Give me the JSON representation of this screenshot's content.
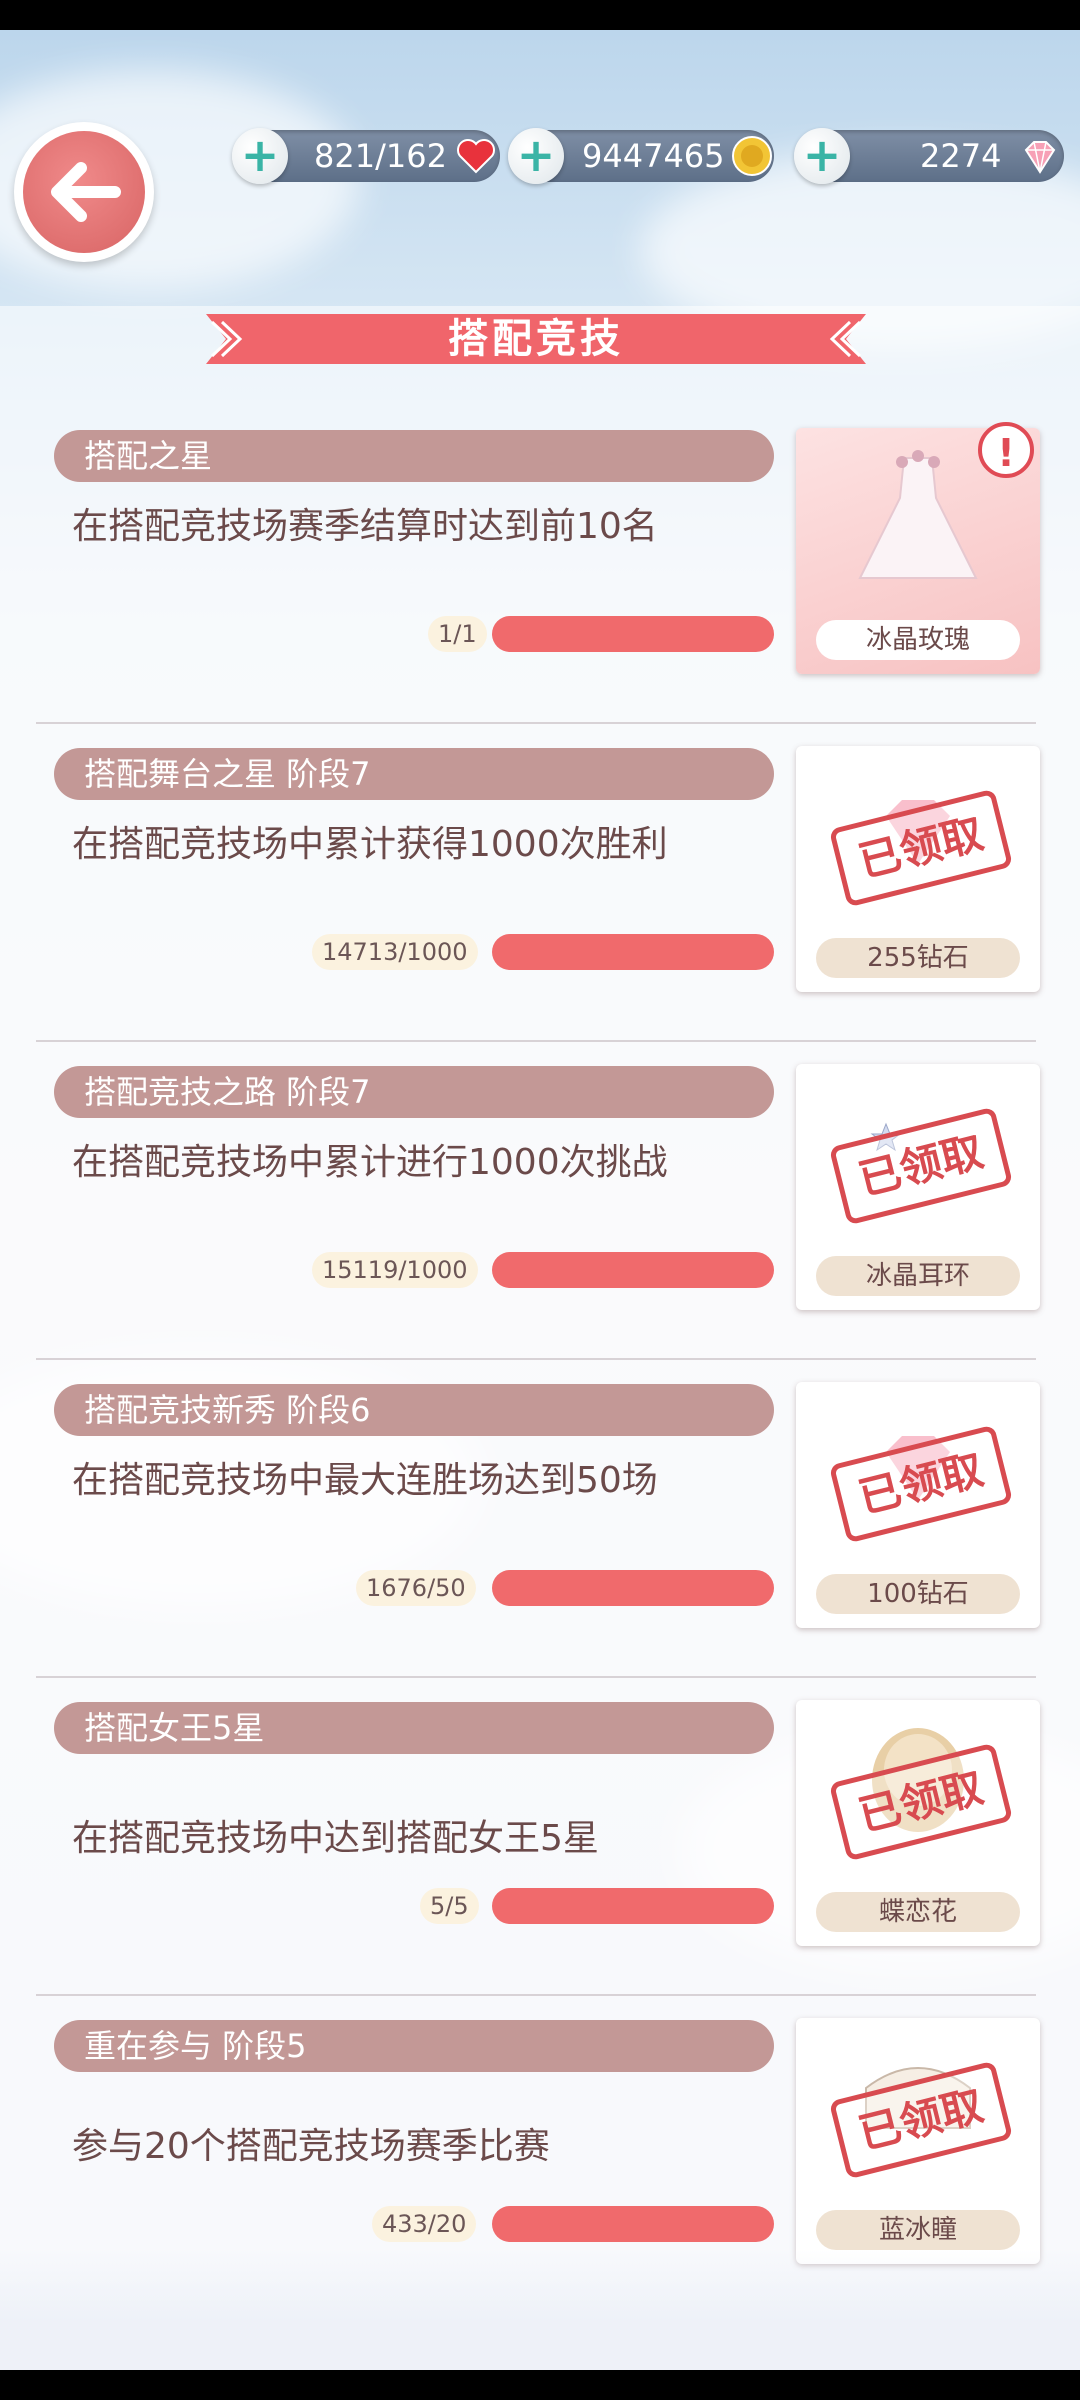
{
  "header": {
    "stamina": "821/162",
    "gold": "9447465",
    "diamonds": "2274",
    "add_icon": "plus-icon",
    "back_icon": "arrow-left-icon"
  },
  "title": "搭配竞技",
  "claimed_stamp": "已领取",
  "tasks": [
    {
      "category": "搭配之星",
      "description": "在搭配竞技场赛季结算时达到前10名",
      "progress": "1/1",
      "reward": "冰晶玫瑰",
      "claimed": false
    },
    {
      "category": "搭配舞台之星 阶段7",
      "description": "在搭配竞技场中累计获得1000次胜利",
      "progress": "14713/1000",
      "reward": "255钻石",
      "claimed": true
    },
    {
      "category": "搭配竞技之路 阶段7",
      "description": "在搭配竞技场中累计进行1000次挑战",
      "progress": "15119/1000",
      "reward": "冰晶耳环",
      "claimed": true
    },
    {
      "category": "搭配竞技新秀 阶段6",
      "description": "在搭配竞技场中最大连胜场达到50场",
      "progress": "1676/50",
      "reward": "100钻石",
      "claimed": true
    },
    {
      "category": "搭配女王5星",
      "description": "在搭配竞技场中达到搭配女王5星",
      "progress": "5/5",
      "reward": "蝶恋花",
      "claimed": true
    },
    {
      "category": "重在参与 阶段5",
      "description": "参与20个搭配竞技场赛季比赛",
      "progress": "433/20",
      "reward": "蓝冰瞳",
      "claimed": true
    }
  ],
  "colors": {
    "accent": "#f06a6c",
    "category_bg": "#c39896",
    "stamp": "#d84b50"
  }
}
